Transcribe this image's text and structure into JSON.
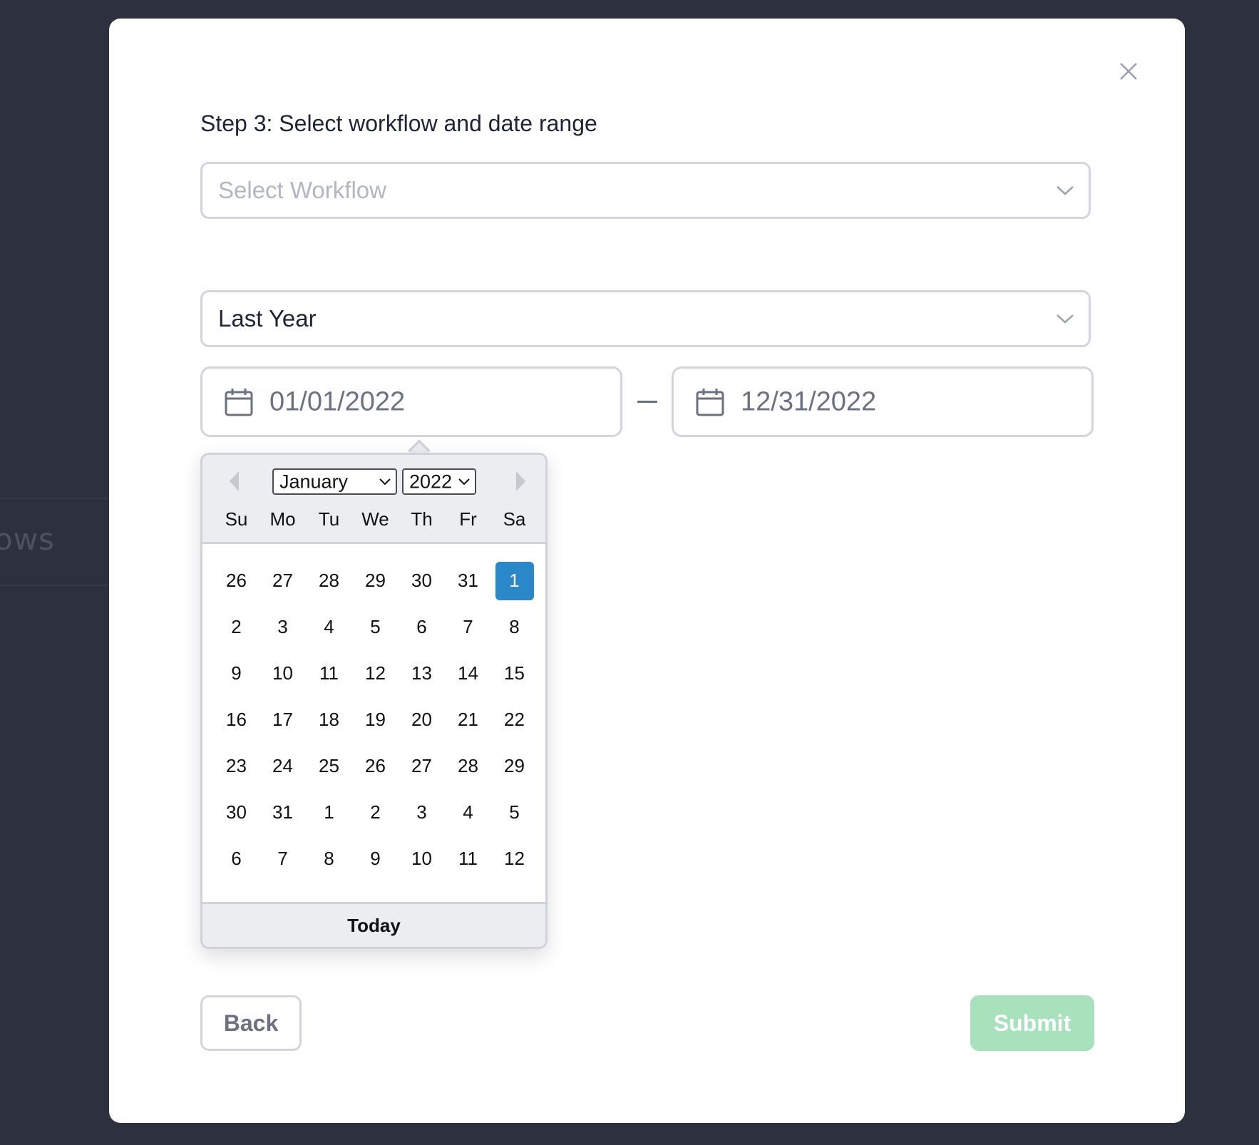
{
  "background": {
    "partial_text": "ows"
  },
  "modal": {
    "step_title": "Step 3: Select workflow and date range",
    "workflow_select": {
      "placeholder": "Select Workflow"
    },
    "range_select": {
      "value": "Last Year"
    },
    "start_date": {
      "value": "01/01/2022"
    },
    "end_date": {
      "value": "12/31/2022"
    },
    "back_label": "Back",
    "submit_label": "Submit"
  },
  "datepicker": {
    "month": "January",
    "year": "2022",
    "weekdays": [
      "Su",
      "Mo",
      "Tu",
      "We",
      "Th",
      "Fr",
      "Sa"
    ],
    "days": [
      "26",
      "27",
      "28",
      "29",
      "30",
      "31",
      "1",
      "2",
      "3",
      "4",
      "5",
      "6",
      "7",
      "8",
      "9",
      "10",
      "11",
      "12",
      "13",
      "14",
      "15",
      "16",
      "17",
      "18",
      "19",
      "20",
      "21",
      "22",
      "23",
      "24",
      "25",
      "26",
      "27",
      "28",
      "29",
      "30",
      "31",
      "1",
      "2",
      "3",
      "4",
      "5",
      "6",
      "7",
      "8",
      "9",
      "10",
      "11",
      "12"
    ],
    "selected_day": "1",
    "today_label": "Today"
  },
  "colors": {
    "selected": "#2b88c8",
    "submit": "#a8e2bd",
    "overlay": "#2d303d"
  }
}
